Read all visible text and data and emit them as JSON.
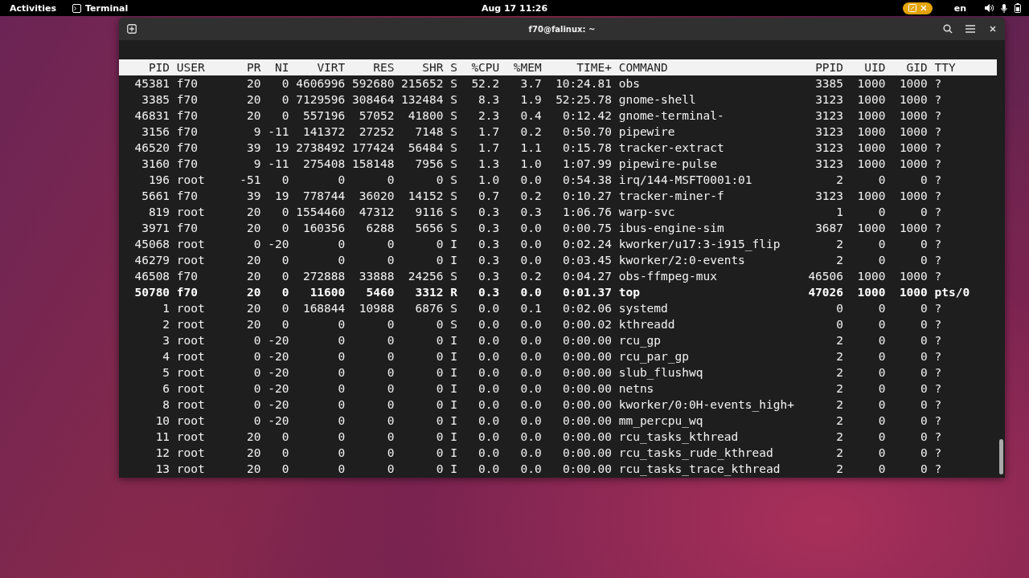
{
  "top_bar": {
    "activities": "Activities",
    "app_name": "Terminal",
    "clock": "Aug 17  11:26",
    "keyboard_layout": "en"
  },
  "window": {
    "title": "f70@falinux: ~"
  },
  "terminal": {
    "columns": [
      "PID",
      "USER",
      "PR",
      "NI",
      "VIRT",
      "RES",
      "SHR",
      "S",
      "%CPU",
      "%MEM",
      "TIME+",
      "COMMAND",
      "PPID",
      "UID",
      "GID",
      "TTY"
    ],
    "rows": [
      {
        "highlighted": false,
        "cells": [
          "45381",
          "f70",
          "20",
          "0",
          "4606996",
          "592680",
          "215652",
          "S",
          "52.2",
          "3.7",
          "10:24.81",
          "obs",
          "3385",
          "1000",
          "1000",
          "?"
        ]
      },
      {
        "highlighted": false,
        "cells": [
          "3385",
          "f70",
          "20",
          "0",
          "7129596",
          "308464",
          "132484",
          "S",
          "8.3",
          "1.9",
          "52:25.78",
          "gnome-shell",
          "3123",
          "1000",
          "1000",
          "?"
        ]
      },
      {
        "highlighted": false,
        "cells": [
          "46831",
          "f70",
          "20",
          "0",
          "557196",
          "57052",
          "41800",
          "S",
          "2.3",
          "0.4",
          "0:12.42",
          "gnome-terminal-",
          "3123",
          "1000",
          "1000",
          "?"
        ]
      },
      {
        "highlighted": false,
        "cells": [
          "3156",
          "f70",
          "9",
          "-11",
          "141372",
          "27252",
          "7148",
          "S",
          "1.7",
          "0.2",
          "0:50.70",
          "pipewire",
          "3123",
          "1000",
          "1000",
          "?"
        ]
      },
      {
        "highlighted": false,
        "cells": [
          "46520",
          "f70",
          "39",
          "19",
          "2738492",
          "177424",
          "56484",
          "S",
          "1.7",
          "1.1",
          "0:15.78",
          "tracker-extract",
          "3123",
          "1000",
          "1000",
          "?"
        ]
      },
      {
        "highlighted": false,
        "cells": [
          "3160",
          "f70",
          "9",
          "-11",
          "275408",
          "158148",
          "7956",
          "S",
          "1.3",
          "1.0",
          "1:07.99",
          "pipewire-pulse",
          "3123",
          "1000",
          "1000",
          "?"
        ]
      },
      {
        "highlighted": false,
        "cells": [
          "196",
          "root",
          "-51",
          "0",
          "0",
          "0",
          "0",
          "S",
          "1.0",
          "0.0",
          "0:54.38",
          "irq/144-MSFT0001:01",
          "2",
          "0",
          "0",
          "?"
        ]
      },
      {
        "highlighted": false,
        "cells": [
          "5661",
          "f70",
          "39",
          "19",
          "778744",
          "36020",
          "14152",
          "S",
          "0.7",
          "0.2",
          "0:10.27",
          "tracker-miner-f",
          "3123",
          "1000",
          "1000",
          "?"
        ]
      },
      {
        "highlighted": false,
        "cells": [
          "819",
          "root",
          "20",
          "0",
          "1554460",
          "47312",
          "9116",
          "S",
          "0.3",
          "0.3",
          "1:06.76",
          "warp-svc",
          "1",
          "0",
          "0",
          "?"
        ]
      },
      {
        "highlighted": false,
        "cells": [
          "3971",
          "f70",
          "20",
          "0",
          "160356",
          "6288",
          "5656",
          "S",
          "0.3",
          "0.0",
          "0:00.75",
          "ibus-engine-sim",
          "3687",
          "1000",
          "1000",
          "?"
        ]
      },
      {
        "highlighted": false,
        "cells": [
          "45068",
          "root",
          "0",
          "-20",
          "0",
          "0",
          "0",
          "I",
          "0.3",
          "0.0",
          "0:02.24",
          "kworker/u17:3-i915_flip",
          "2",
          "0",
          "0",
          "?"
        ]
      },
      {
        "highlighted": false,
        "cells": [
          "46279",
          "root",
          "20",
          "0",
          "0",
          "0",
          "0",
          "I",
          "0.3",
          "0.0",
          "0:03.45",
          "kworker/2:0-events",
          "2",
          "0",
          "0",
          "?"
        ]
      },
      {
        "highlighted": false,
        "cells": [
          "46508",
          "f70",
          "20",
          "0",
          "272888",
          "33888",
          "24256",
          "S",
          "0.3",
          "0.2",
          "0:04.27",
          "obs-ffmpeg-mux",
          "46506",
          "1000",
          "1000",
          "?"
        ]
      },
      {
        "highlighted": true,
        "cells": [
          "50780",
          "f70",
          "20",
          "0",
          "11600",
          "5460",
          "3312",
          "R",
          "0.3",
          "0.0",
          "0:01.37",
          "top",
          "47026",
          "1000",
          "1000",
          "pts/0"
        ]
      },
      {
        "highlighted": false,
        "cells": [
          "1",
          "root",
          "20",
          "0",
          "168844",
          "10988",
          "6876",
          "S",
          "0.0",
          "0.1",
          "0:02.06",
          "systemd",
          "0",
          "0",
          "0",
          "?"
        ]
      },
      {
        "highlighted": false,
        "cells": [
          "2",
          "root",
          "20",
          "0",
          "0",
          "0",
          "0",
          "S",
          "0.0",
          "0.0",
          "0:00.02",
          "kthreadd",
          "0",
          "0",
          "0",
          "?"
        ]
      },
      {
        "highlighted": false,
        "cells": [
          "3",
          "root",
          "0",
          "-20",
          "0",
          "0",
          "0",
          "I",
          "0.0",
          "0.0",
          "0:00.00",
          "rcu_gp",
          "2",
          "0",
          "0",
          "?"
        ]
      },
      {
        "highlighted": false,
        "cells": [
          "4",
          "root",
          "0",
          "-20",
          "0",
          "0",
          "0",
          "I",
          "0.0",
          "0.0",
          "0:00.00",
          "rcu_par_gp",
          "2",
          "0",
          "0",
          "?"
        ]
      },
      {
        "highlighted": false,
        "cells": [
          "5",
          "root",
          "0",
          "-20",
          "0",
          "0",
          "0",
          "I",
          "0.0",
          "0.0",
          "0:00.00",
          "slub_flushwq",
          "2",
          "0",
          "0",
          "?"
        ]
      },
      {
        "highlighted": false,
        "cells": [
          "6",
          "root",
          "0",
          "-20",
          "0",
          "0",
          "0",
          "I",
          "0.0",
          "0.0",
          "0:00.00",
          "netns",
          "2",
          "0",
          "0",
          "?"
        ]
      },
      {
        "highlighted": false,
        "cells": [
          "8",
          "root",
          "0",
          "-20",
          "0",
          "0",
          "0",
          "I",
          "0.0",
          "0.0",
          "0:00.00",
          "kworker/0:0H-events_high+",
          "2",
          "0",
          "0",
          "?"
        ]
      },
      {
        "highlighted": false,
        "cells": [
          "10",
          "root",
          "0",
          "-20",
          "0",
          "0",
          "0",
          "I",
          "0.0",
          "0.0",
          "0:00.00",
          "mm_percpu_wq",
          "2",
          "0",
          "0",
          "?"
        ]
      },
      {
        "highlighted": false,
        "cells": [
          "11",
          "root",
          "20",
          "0",
          "0",
          "0",
          "0",
          "I",
          "0.0",
          "0.0",
          "0:00.00",
          "rcu_tasks_kthread",
          "2",
          "0",
          "0",
          "?"
        ]
      },
      {
        "highlighted": false,
        "cells": [
          "12",
          "root",
          "20",
          "0",
          "0",
          "0",
          "0",
          "I",
          "0.0",
          "0.0",
          "0:00.00",
          "rcu_tasks_rude_kthread",
          "2",
          "0",
          "0",
          "?"
        ]
      },
      {
        "highlighted": false,
        "cells": [
          "13",
          "root",
          "20",
          "0",
          "0",
          "0",
          "0",
          "I",
          "0.0",
          "0.0",
          "0:00.00",
          "rcu_tasks_trace_kthread",
          "2",
          "0",
          "0",
          "?"
        ]
      }
    ]
  }
}
